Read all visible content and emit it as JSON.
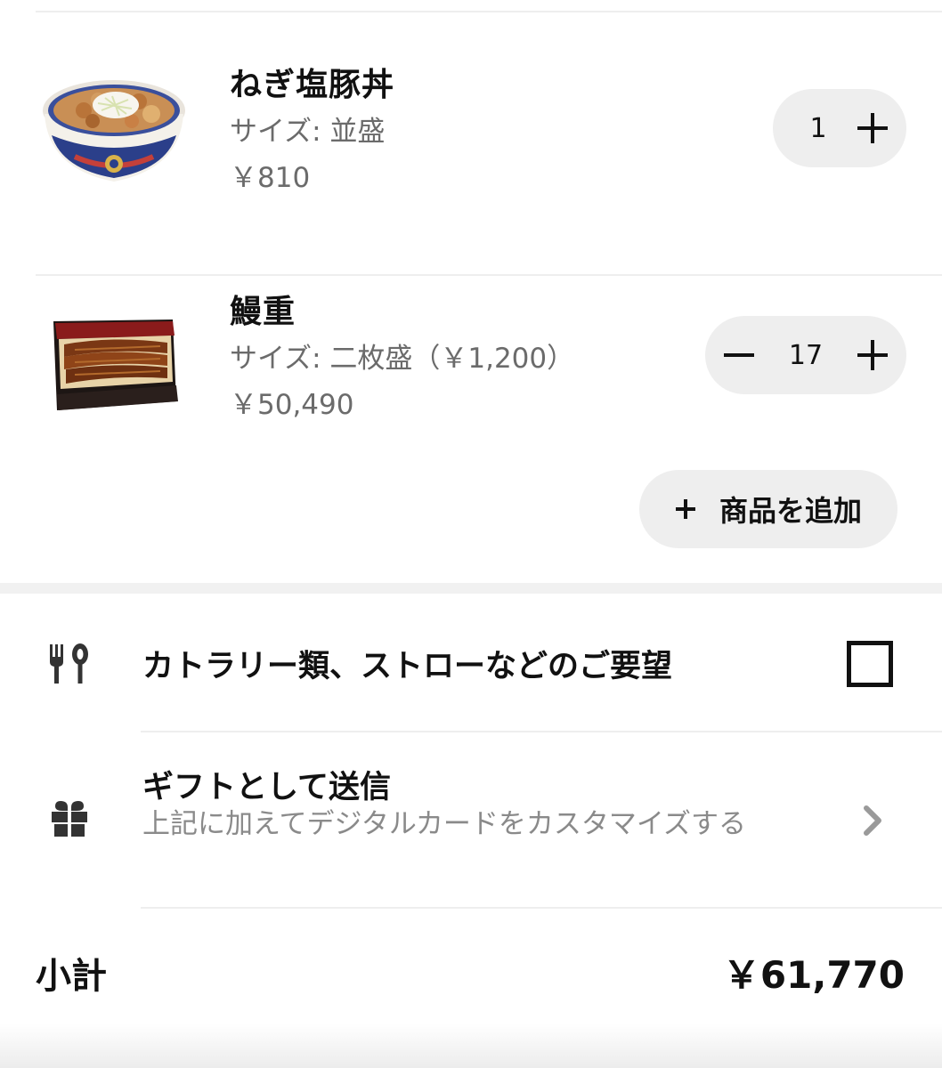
{
  "cart": {
    "items": [
      {
        "name": "ねぎ塩豚丼",
        "size": "サイズ: 並盛",
        "price": "￥810",
        "quantity": "1",
        "image_icon": "negi-shio-butadon-bowl-image"
      },
      {
        "name": "鰻重",
        "size": "サイズ: 二枚盛（￥1,200）",
        "price": "￥50,490",
        "quantity": "17",
        "image_icon": "unaju-box-image"
      }
    ],
    "add_item_label": "商品を追加",
    "add_item_icon": "plus-icon"
  },
  "options": {
    "cutlery": {
      "label": "カトラリー類、ストローなどのご要望",
      "icon": "cutlery-icon",
      "checked": false
    },
    "gift": {
      "title": "ギフトとして送信",
      "description": "上記に加えてデジタルカードをカスタマイズする",
      "icon": "gift-icon"
    }
  },
  "subtotal": {
    "label": "小計",
    "value": "￥61,770"
  },
  "colors": {
    "pill_background": "#eeeeee",
    "secondary_text": "#6b6b6b",
    "divider": "#eeeeee"
  }
}
